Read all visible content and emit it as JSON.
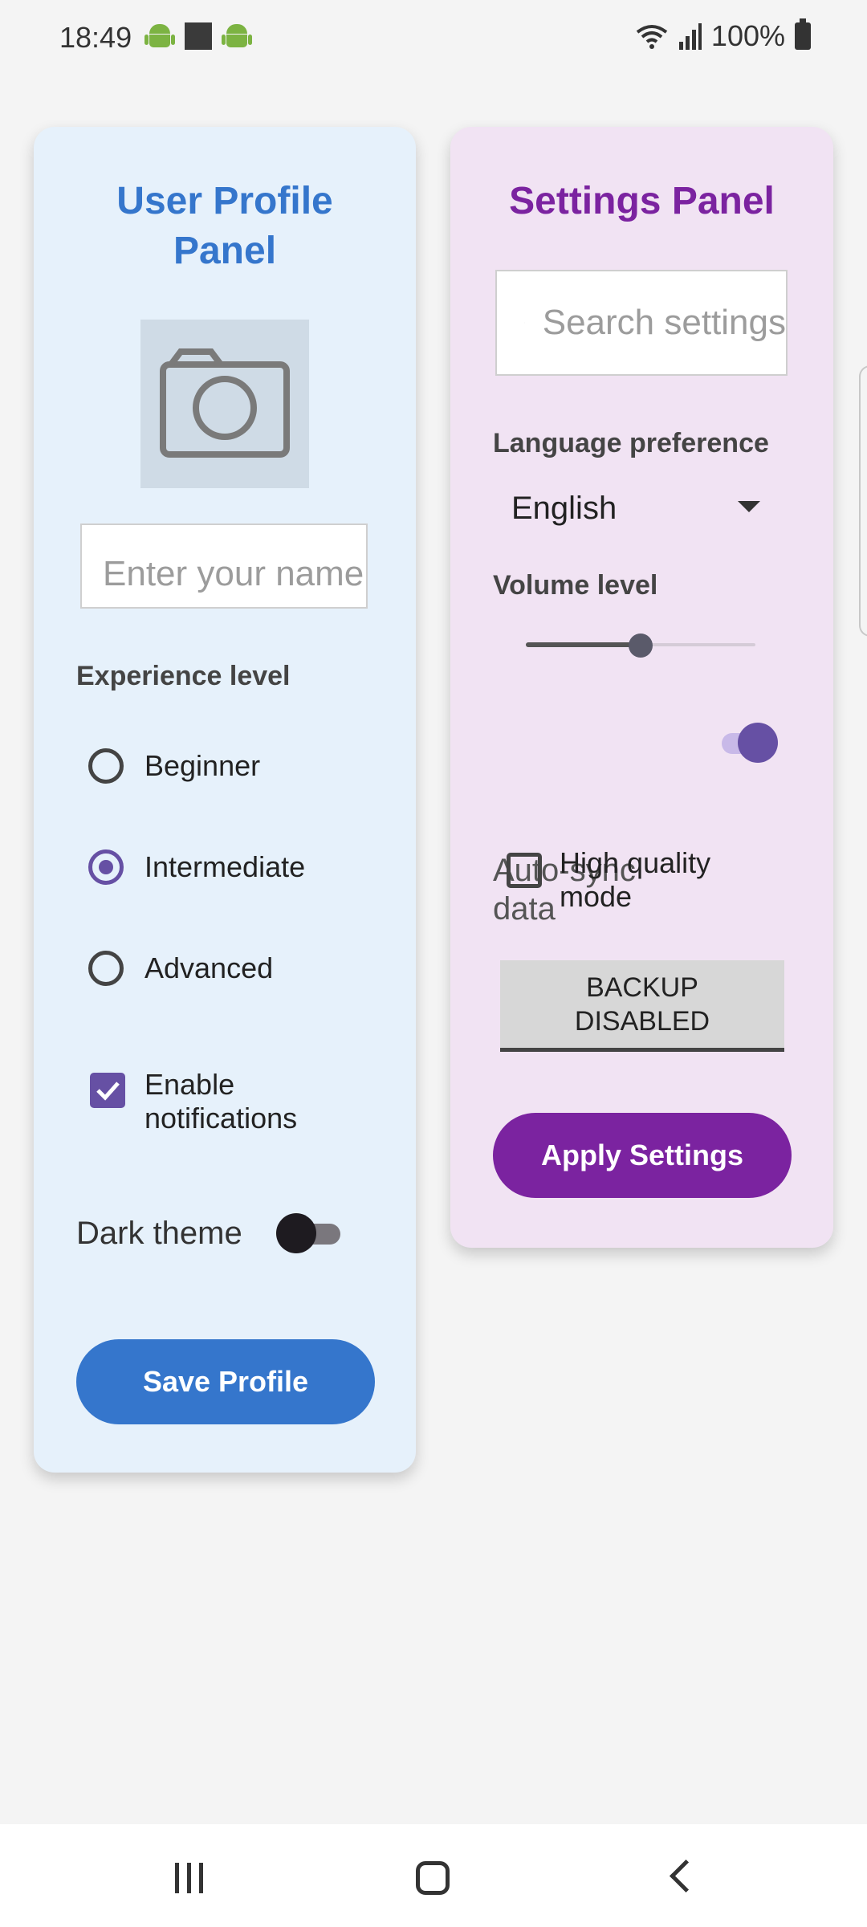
{
  "status_bar": {
    "time": "18:49",
    "battery": "100%",
    "icons": [
      "android-icon",
      "square-icon",
      "android-icon",
      "wifi-icon",
      "signal-icon",
      "battery-icon"
    ]
  },
  "user_panel": {
    "title": "User Profile Panel",
    "photo_icon": "camera-icon",
    "name_placeholder": "Enter your name",
    "experience_label": "Experience level",
    "experience_options": [
      "Beginner",
      "Intermediate",
      "Advanced"
    ],
    "experience_selected": "Intermediate",
    "notifications_label": "Enable notifications",
    "notifications_checked": true,
    "dark_theme_label": "Dark theme",
    "dark_theme_on": false,
    "save_button": "Save Profile"
  },
  "settings_panel": {
    "title": "Settings Panel",
    "search_placeholder": "Search settings",
    "language_label": "Language preference",
    "language_value": "English",
    "volume_label": "Volume level",
    "volume_fraction": 0.5,
    "autosync_label": "Auto-sync data",
    "autosync_on": true,
    "high_quality_label": "High quality mode",
    "high_quality_checked": false,
    "backup_button": "BACKUP DISABLED",
    "apply_button": "Apply Settings"
  },
  "colors": {
    "user_accent": "#3576cc",
    "settings_accent": "#7b23a0",
    "control_accent": "#6650a4",
    "user_panel_bg": "#e6f1fb",
    "settings_panel_bg": "#f1e3f3"
  }
}
